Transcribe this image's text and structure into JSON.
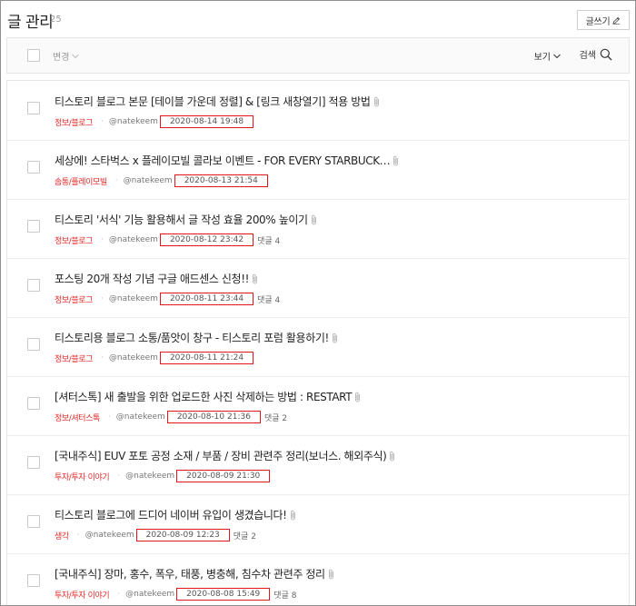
{
  "header": {
    "title": "글 관리",
    "count": "25",
    "write_label": "글쓰기",
    "write_icon": "pencil-icon"
  },
  "toolbar": {
    "change_label": "변경",
    "view_label": "보기",
    "search_label": "검색",
    "search_icon": "search-icon"
  },
  "colors": {
    "category": "#e52929",
    "date_box": "#e0161c"
  },
  "posts": [
    {
      "title": "티스토리 블로그 본문 [테이블 가운데 정렬] & [링크 새창열기] 적용 방법",
      "category": "정보/블로그",
      "author": "@natekeem",
      "date": "2020-08-14 19:48",
      "comments": ""
    },
    {
      "title": "세상에! 스타벅스 x 플레이모빌 콜라보 이벤트 - FOR EVERY STARBUCK…",
      "category": "솜통/플레이모빌",
      "author": "@natekeem",
      "date": "2020-08-13 21:54",
      "comments": ""
    },
    {
      "title": "티스토리 '서식' 기능 활용해서 글 작성 효율 200% 높이기",
      "category": "정보/블로그",
      "author": "@natekeem",
      "date": "2020-08-12 23:42",
      "comments": "댓글 4"
    },
    {
      "title": "포스팅 20개 작성 기념 구글 애드센스 신청!!",
      "category": "정보/블로그",
      "author": "@natekeem",
      "date": "2020-08-11 23:44",
      "comments": "댓글 4"
    },
    {
      "title": "티스토리용 블로그 소통/품앗이 창구 - 티스토리 포럼 활용하기!",
      "category": "정보/블로그",
      "author": "@natekeem",
      "date": "2020-08-11 21:24",
      "comments": ""
    },
    {
      "title": "[셔터스톡] 새 출발을 위한 업로드한 사진 삭제하는 방법 : RESTART",
      "category": "정보/셔터스톡",
      "author": "@natekeem",
      "date": "2020-08-10 21:36",
      "comments": "댓글 2"
    },
    {
      "title": "[국내주식] EUV 포토 공정 소재 / 부품 / 장비 관련주 정리(보너스. 해외주식)",
      "category": "투자/투자 이야기",
      "author": "@natekeem",
      "date": "2020-08-09 21:30",
      "comments": ""
    },
    {
      "title": "티스토리 블로그에 드디어 네이버 유입이 생겼습니다!",
      "category": "생각",
      "author": "@natekeem",
      "date": "2020-08-09 12:23",
      "comments": "댓글 2"
    },
    {
      "title": "[국내주식] 장마, 홍수, 폭우, 태풍, 병충해, 침수차 관련주 정리",
      "category": "투자/투자 이야기",
      "author": "@natekeem",
      "date": "2020-08-08 15:49",
      "comments": "댓글 8"
    }
  ]
}
